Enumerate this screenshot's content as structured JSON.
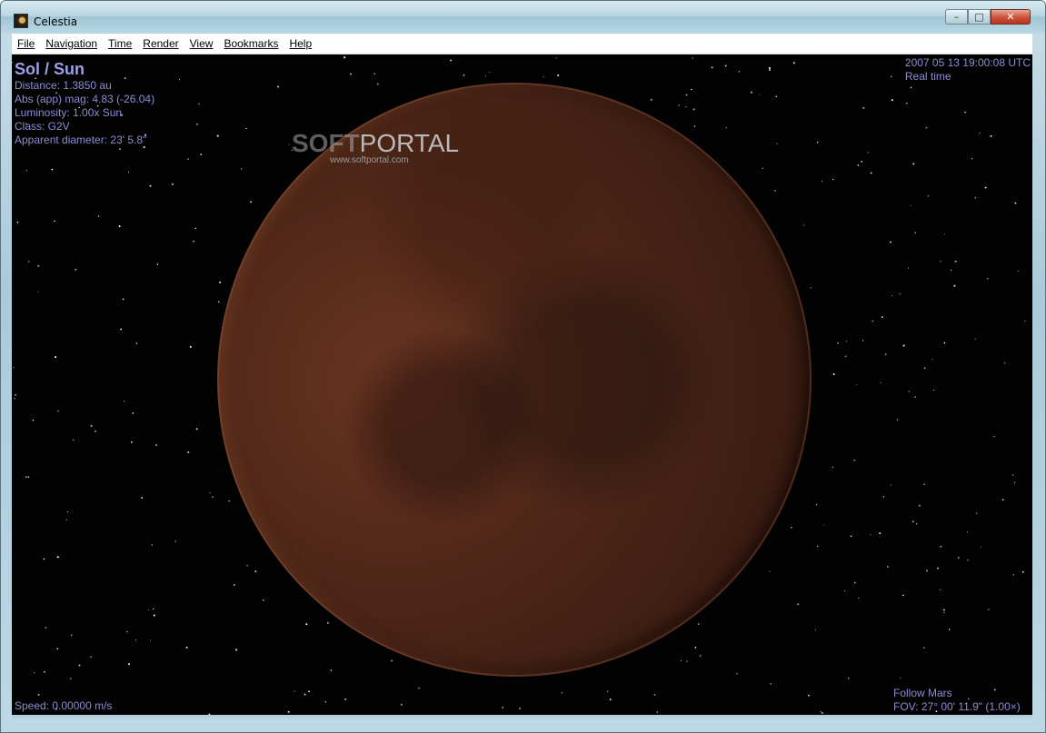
{
  "window": {
    "title": "Celestia",
    "caption": {
      "minimize": "–",
      "maximize": "□",
      "close": "✕"
    }
  },
  "menu": [
    {
      "label": "File"
    },
    {
      "label": "Navigation"
    },
    {
      "label": "Time"
    },
    {
      "label": "Render"
    },
    {
      "label": "View"
    },
    {
      "label": "Bookmarks"
    },
    {
      "label": "Help"
    }
  ],
  "hud": {
    "object_name": "Sol / Sun",
    "distance": "Distance: 1.3850 au",
    "abs_mag": "Abs (app) mag: 4.83 (-26.04)",
    "luminosity": "Luminosity: 1.00x Sun",
    "class": "Class: G2V",
    "apparent_diameter": "Apparent diameter: 23' 5.8\"",
    "datetime": "2007 05 13 19:00:08 UTC",
    "time_mode": "Real time",
    "follow": "Follow Mars",
    "fov": "FOV: 27° 00' 11.9\" (1.00×)",
    "speed": "Speed: 0.00000 m/s"
  },
  "watermark": {
    "soft": "SOFT",
    "portal": "PORTAL",
    "url": "www.softportal.com"
  },
  "colors": {
    "hud_text": "#8c8cd2",
    "space": "#020203",
    "planet": "#4e2718"
  },
  "icons": [
    "celestia-app-icon",
    "minimize-icon",
    "maximize-icon",
    "close-icon"
  ]
}
